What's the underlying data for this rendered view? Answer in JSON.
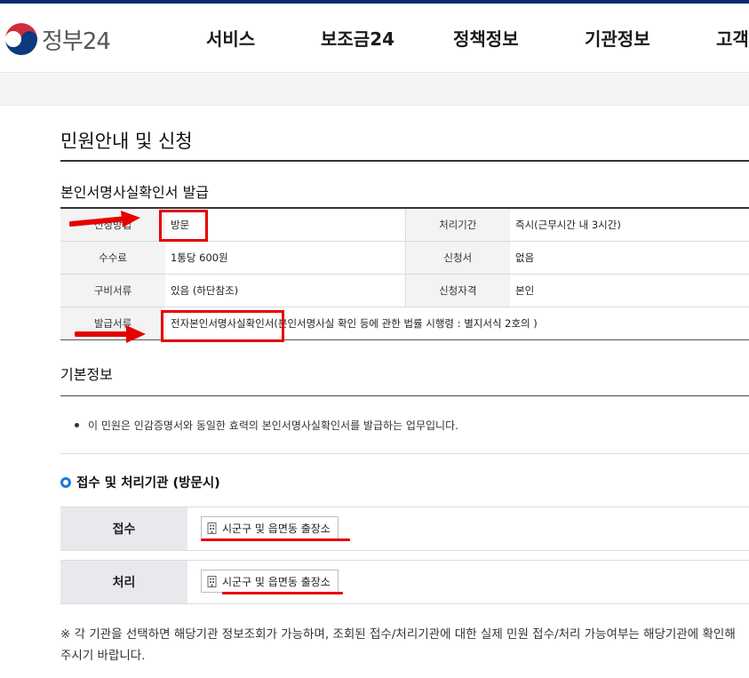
{
  "header": {
    "logo_text": "정부24",
    "nav": [
      "서비스",
      "보조금24",
      "정책정보",
      "기관정보",
      "고객"
    ]
  },
  "page_title": "민원안내 및 신청",
  "service_title": "본인서명사실확인서 발급",
  "info_table": {
    "rows": [
      {
        "label": "신청방법",
        "value": "방문",
        "label2": "처리기간",
        "value2": "즉시(근무시간 내 3시간)"
      },
      {
        "label": "수수료",
        "value": "1통당 600원",
        "label2": "신청서",
        "value2": "없음"
      },
      {
        "label": "구비서류",
        "value": "있음 (하단참조)",
        "label2": "신청자격",
        "value2": "본인"
      }
    ],
    "issue_label": "발급서류",
    "issue_value": "전자본인서명사실확인서",
    "issue_note": "(본인서명사실 확인 등에 관한 법률 시행령 : 별지서식 2호의 )"
  },
  "basic_info": {
    "title": "기본정보",
    "bullet": "이 민원은 인감증명서와 동일한 효력의 본인서명사실확인서를 발급하는 업무입니다."
  },
  "agencies": {
    "title": "접수 및 처리기관 (방문시)",
    "receive_label": "접수",
    "receive_button": "시군구 및 읍면동 출장소",
    "process_label": "처리",
    "process_button": "시군구 및 읍면동 출장소"
  },
  "note": "※ 각 기관을 선택하면 해당기관 정보조회가 가능하며, 조회된 접수/처리기관에 대한 실제 민원 접수/처리 가능여부는 해당기관에 확인해 주시기 바랍니다.",
  "colors": {
    "annotation_red": "#e60000",
    "accent_blue": "#1d7bd8",
    "header_navy": "#0b2a6b"
  }
}
